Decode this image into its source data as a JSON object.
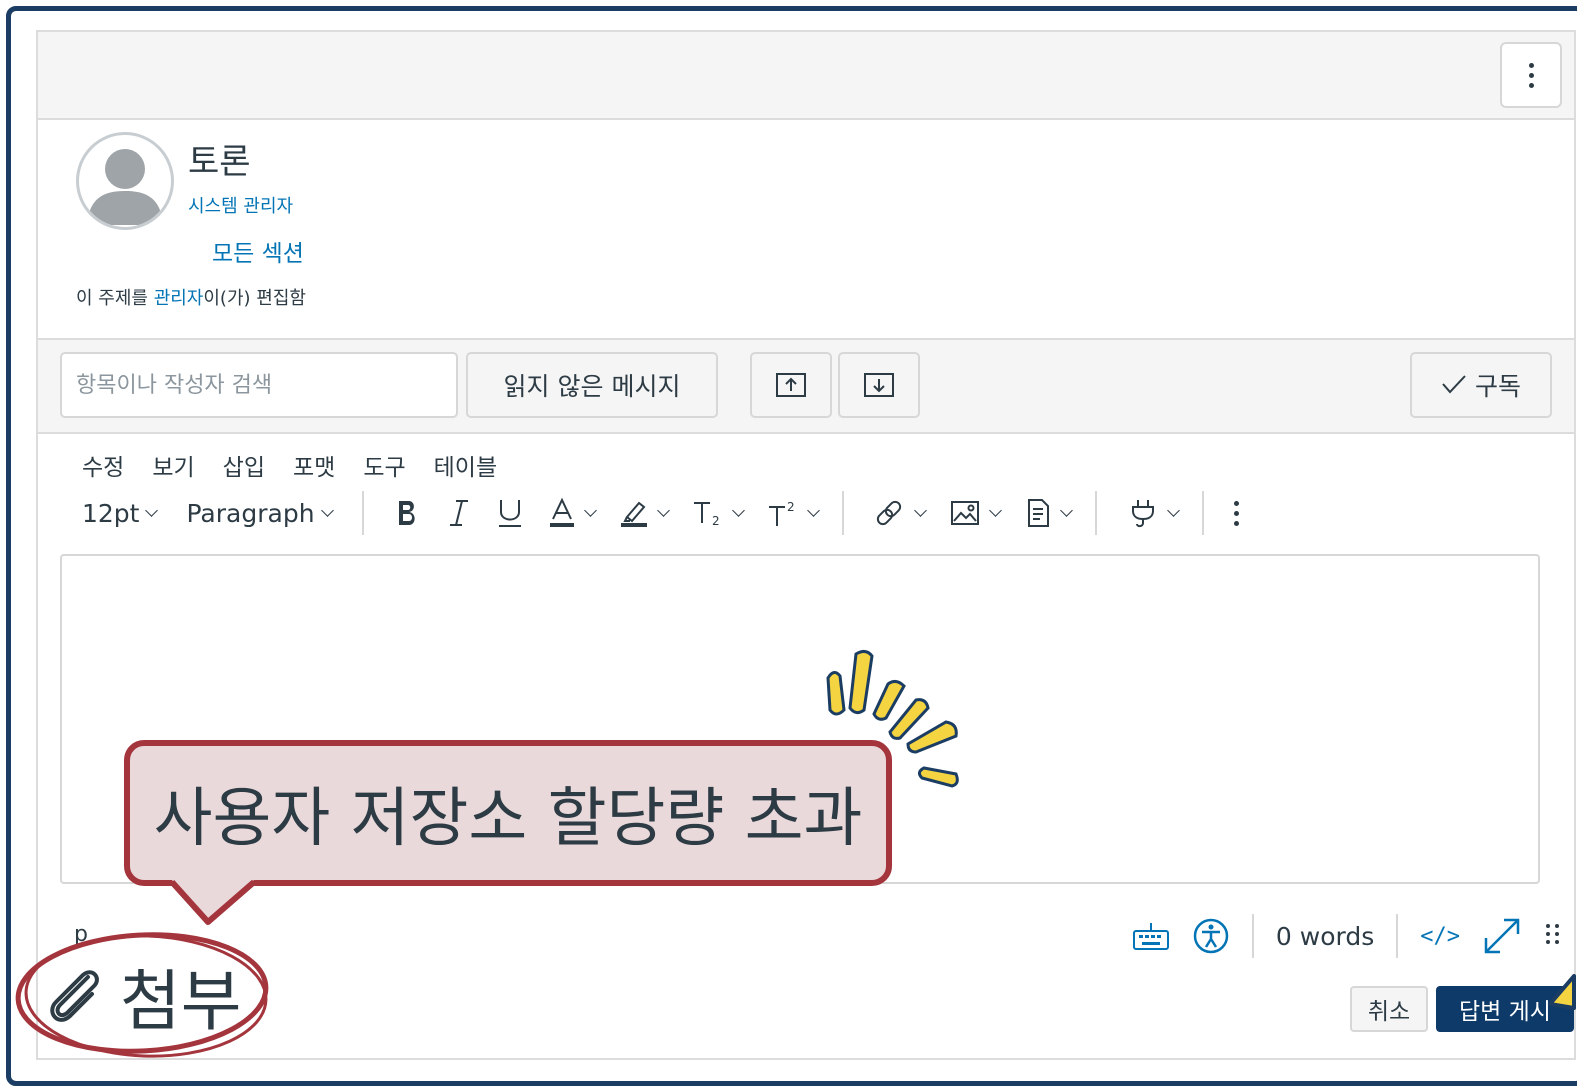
{
  "header": {
    "more_label": "more options"
  },
  "author": {
    "name": "토론",
    "role": "시스템 관리자",
    "sections_link": "모든 섹션",
    "edited_prefix": "이 주제를 ",
    "edited_link": "관리자",
    "edited_suffix": "이(가) 편집함"
  },
  "toolbar": {
    "search_placeholder": "항목이나 작성자 검색",
    "unread_label": "읽지 않은 메시지",
    "subscribe_label": "구독"
  },
  "editor": {
    "menu": [
      "수정",
      "보기",
      "삽입",
      "포맷",
      "도구",
      "테이블"
    ],
    "font_size": "12pt",
    "block_format": "Paragraph",
    "path": "p",
    "word_count": "0 words",
    "code_label": "</>"
  },
  "actions": {
    "cancel_label": "취소",
    "post_label": "답변 게시"
  },
  "annotations": {
    "callout_text": "사용자 저장소 할당량 초과",
    "attach_label": "첨부"
  },
  "colors": {
    "accent": "#0374b5",
    "primary_button": "#0e3a6a",
    "callout_border": "#a4353d",
    "callout_fill": "#ead9da",
    "spark": "#f5d442",
    "frame": "#1b3d63"
  }
}
